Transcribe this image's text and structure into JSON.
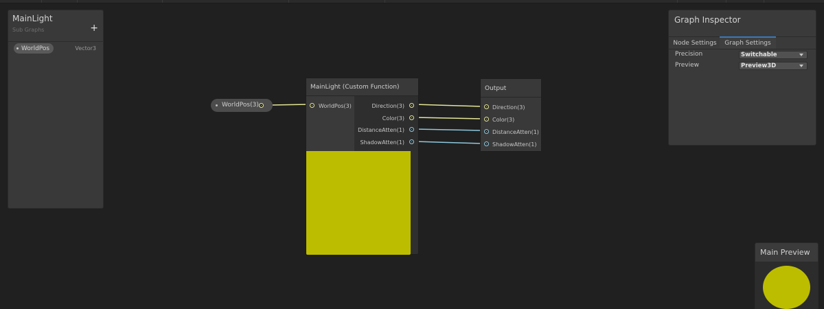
{
  "colors": {
    "canvas": "#202020",
    "yellow_wire": "#e4e695",
    "cyan_wire": "#8ec9df",
    "preview_fill": "#bdbd00",
    "tab_accent": "#3a79bb"
  },
  "blackboard": {
    "title": "MainLight",
    "subtitle": "Sub Graphs",
    "add_icon": "+",
    "property": {
      "name": "WorldPos",
      "type": "Vector3"
    }
  },
  "property_node": {
    "label": "WorldPos(3)"
  },
  "custom_function_node": {
    "title": "MainLight (Custom Function)",
    "inputs": [
      {
        "label": "WorldPos(3)"
      }
    ],
    "outputs": [
      {
        "label": "Direction(3)"
      },
      {
        "label": "Color(3)"
      },
      {
        "label": "DistanceAtten(1)"
      },
      {
        "label": "ShadowAtten(1)"
      }
    ]
  },
  "output_node": {
    "title": "Output",
    "inputs": [
      {
        "label": "Direction(3)"
      },
      {
        "label": "Color(3)"
      },
      {
        "label": "DistanceAtten(1)"
      },
      {
        "label": "ShadowAtten(1)"
      }
    ]
  },
  "inspector": {
    "title": "Graph Inspector",
    "tabs": {
      "node": "Node Settings",
      "graph": "Graph Settings"
    },
    "active_tab": "Graph Settings",
    "precision": {
      "label": "Precision",
      "value": "Switchable"
    },
    "preview": {
      "label": "Preview",
      "value": "Preview3D"
    }
  },
  "main_preview": {
    "title": "Main Preview"
  }
}
